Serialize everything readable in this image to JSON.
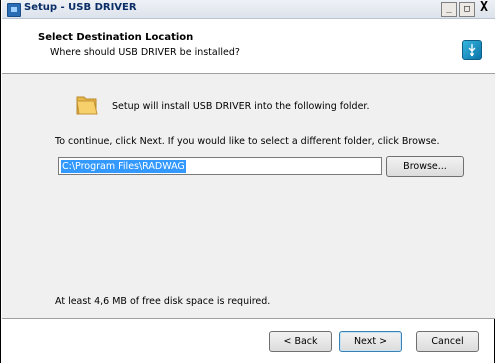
{
  "window": {
    "title": "Setup - USB DRIVER",
    "minimize_label": "_",
    "maximize_label": "□",
    "close_label": "X"
  },
  "header": {
    "title": "Select Destination Location",
    "subtitle": "Where should USB DRIVER be installed?"
  },
  "main": {
    "install_message": "Setup will install USB DRIVER into the following folder.",
    "continue_message": "To continue, click Next. If you would like to select a different folder, click Browse.",
    "path_value": "C:\\Program Files\\RADWAG",
    "browse_label": "Browse...",
    "space_message": "At least 4,6 MB of free disk space is required."
  },
  "footer": {
    "back_label": "< Back",
    "next_label": "Next >",
    "cancel_label": "Cancel"
  },
  "icons": {
    "app": "setup-app-icon",
    "wizard": "usb-icon",
    "folder": "folder-icon"
  },
  "colors": {
    "selection": "#3399ff",
    "panel": "#f0f0f0",
    "title_text": "#0a2d66"
  }
}
